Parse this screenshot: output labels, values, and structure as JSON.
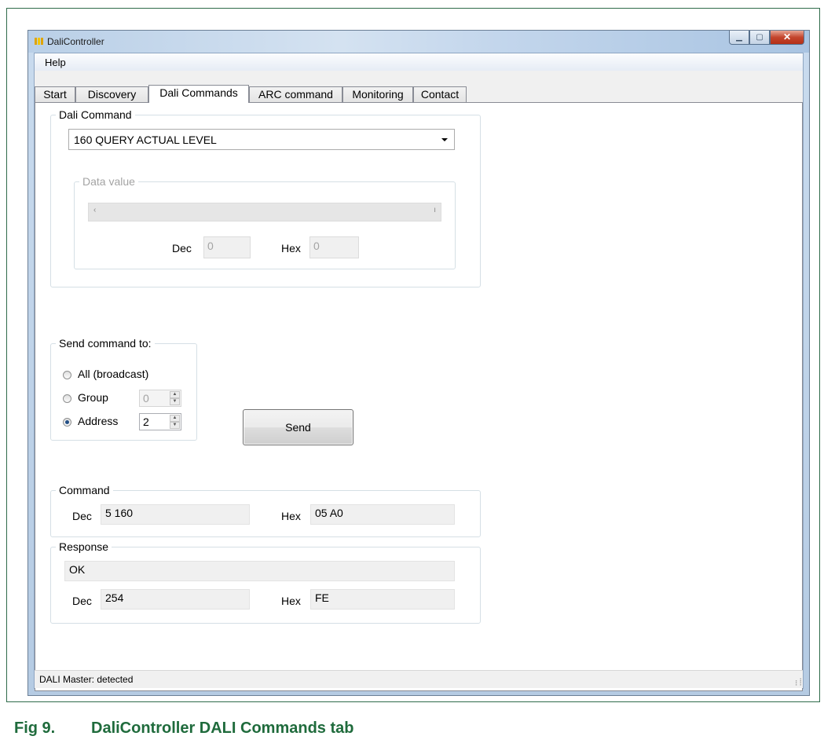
{
  "window": {
    "title": "DaliController"
  },
  "menu": {
    "help": "Help"
  },
  "tabs": [
    "Start",
    "Discovery",
    "Dali Commands",
    "ARC command",
    "Monitoring",
    "Contact"
  ],
  "active_tab": "Dali Commands",
  "dali_command": {
    "group_label": "Dali Command",
    "selected": "160 QUERY ACTUAL LEVEL",
    "data_value": {
      "group_label": "Data value",
      "slider_value": 0,
      "dec_label": "Dec",
      "dec_value": "0",
      "hex_label": "Hex",
      "hex_value": "0"
    }
  },
  "send_to": {
    "group_label": "Send command to:",
    "options": {
      "all": "All (broadcast)",
      "group": "Group",
      "address": "Address"
    },
    "selected": "address",
    "group_value": "0",
    "address_value": "2"
  },
  "send_button": "Send",
  "command": {
    "group_label": "Command",
    "dec_label": "Dec",
    "dec_value": "5 160",
    "hex_label": "Hex",
    "hex_value": "05 A0"
  },
  "response": {
    "group_label": "Response",
    "text": "OK",
    "dec_label": "Dec",
    "dec_value": "254",
    "hex_label": "Hex",
    "hex_value": "FE"
  },
  "status": "DALI Master: detected",
  "caption": {
    "number": "Fig 9.",
    "text": "DaliController DALI Commands tab"
  },
  "colors": {
    "caption": "#1f6b3c",
    "frame_border": "#2f6b4a",
    "radio_dot": "#234f86"
  }
}
